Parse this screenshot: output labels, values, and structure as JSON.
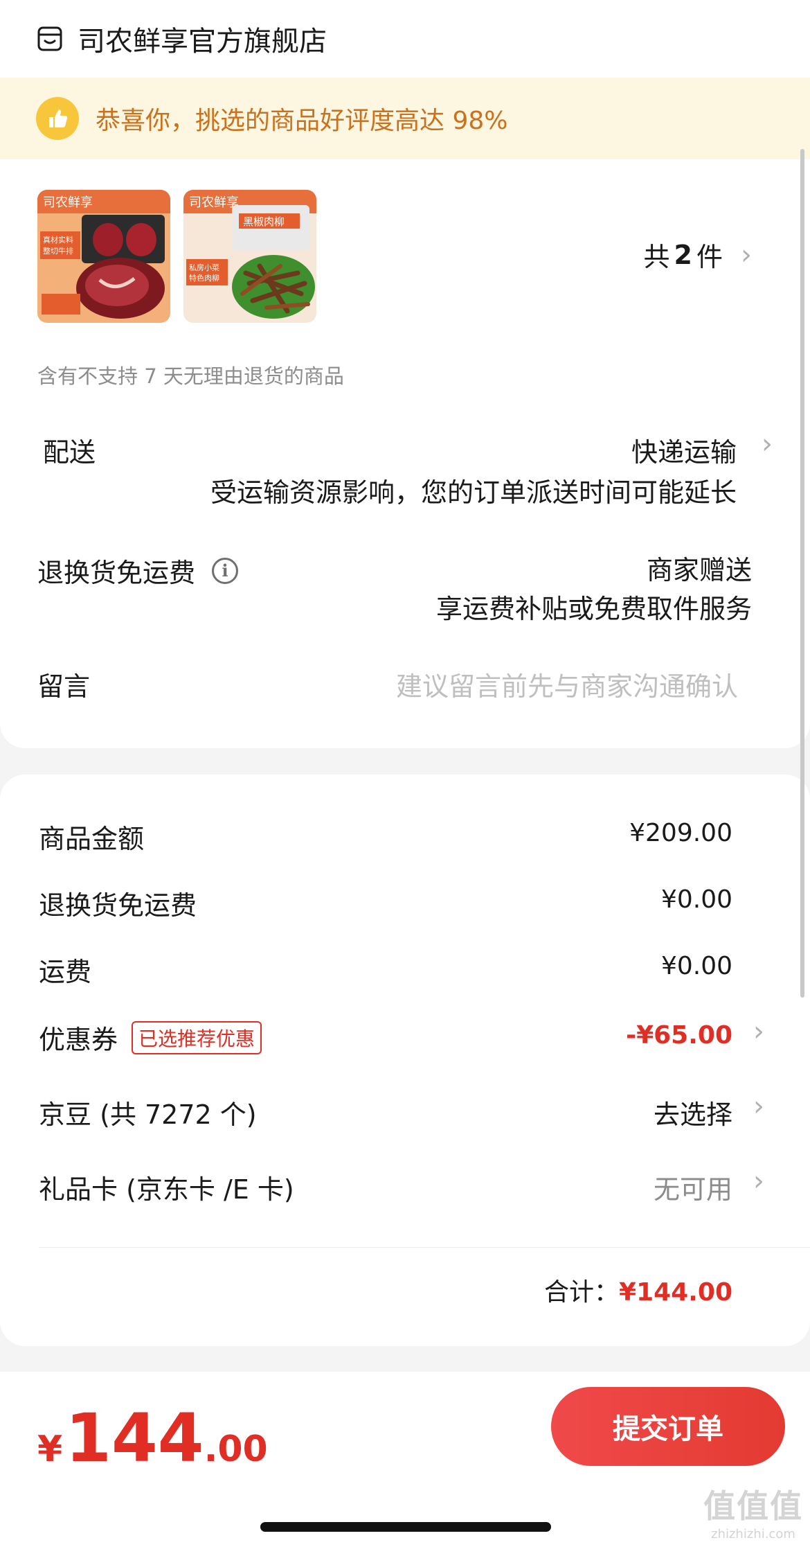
{
  "store": {
    "name": "司农鲜享官方旗舰店",
    "icon": "store-icon"
  },
  "rating_banner": {
    "text": "恭喜你，挑选的商品好评度高达 98%",
    "icon": "thumbs-up-icon"
  },
  "products": {
    "count_prefix": "共",
    "count": "2",
    "count_suffix": "件",
    "items": [
      {
        "brand": "司农鲜享",
        "line1": "真材实料",
        "line2": "整切牛排",
        "icon": "steak-product-image"
      },
      {
        "brand": "司农鲜享",
        "title": "黑椒肉柳",
        "line1": "私房小菜",
        "line2": "特色肉柳",
        "icon": "pork-strips-product-image"
      }
    ],
    "no_return_notice": "含有不支持 7 天无理由退货的商品"
  },
  "delivery": {
    "label": "配送",
    "method": "快递运输",
    "notice": "受运输资源影响，您的订单派送时间可能延长"
  },
  "return_shipping": {
    "label": "退换货免运费",
    "value": "商家赠送",
    "detail": "享运费补贴或免费取件服务"
  },
  "message": {
    "label": "留言",
    "placeholder": "建议留言前先与商家沟通确认"
  },
  "fees": {
    "goods_label": "商品金额",
    "goods_value": "¥209.00",
    "return_label": "退换货免运费",
    "return_value": "¥0.00",
    "shipping_label": "运费",
    "shipping_value": "¥0.00",
    "coupon_label": "优惠券",
    "coupon_tag": "已选推荐优惠",
    "coupon_value": "-¥65.00",
    "jingdou_label": "京豆 (共 7272 个)",
    "jingdou_value": "去选择",
    "giftcard_label": "礼品卡 (京东卡 /E 卡)",
    "giftcard_value": "无可用",
    "total_label": "合计：",
    "total_value": "¥144.00"
  },
  "footer": {
    "currency": "¥",
    "amount_int": "144",
    "amount_dec": ".00",
    "submit_label": "提交订单"
  },
  "watermark": {
    "top": "值值值",
    "bottom": "zhizhizhi.com"
  },
  "colors": {
    "accent_red": "#e02e24",
    "banner_bg": "#fdf6e1",
    "banner_text": "#c9711d"
  }
}
